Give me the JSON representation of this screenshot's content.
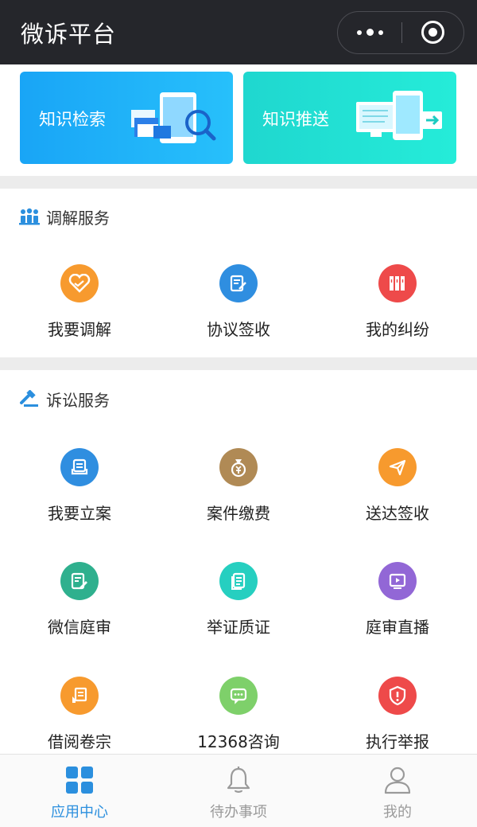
{
  "header": {
    "title": "微诉平台"
  },
  "banners": [
    {
      "label": "知识检索",
      "icon": "search-document-illustration"
    },
    {
      "label": "知识推送",
      "icon": "push-devices-illustration"
    }
  ],
  "mediation": {
    "title": "调解服务",
    "items": [
      {
        "label": "我要调解",
        "icon": "handshake-heart-icon",
        "color": "#f79a2e"
      },
      {
        "label": "协议签收",
        "icon": "edit-document-icon",
        "color": "#2f8ee0"
      },
      {
        "label": "我的纠纷",
        "icon": "folders-icon",
        "color": "#ee4a4a"
      }
    ]
  },
  "litigation": {
    "title": "诉讼服务",
    "items": [
      {
        "label": "我要立案",
        "icon": "file-stack-icon",
        "color": "#2f8ee0"
      },
      {
        "label": "案件缴费",
        "icon": "money-bag-icon",
        "color": "#b08a55"
      },
      {
        "label": "送达签收",
        "icon": "paper-plane-icon",
        "color": "#f79a2e"
      },
      {
        "label": "微信庭审",
        "icon": "document-pen-icon",
        "color": "#2fb08e"
      },
      {
        "label": "举证质证",
        "icon": "copy-document-icon",
        "color": "#26cfc0"
      },
      {
        "label": "庭审直播",
        "icon": "video-play-icon",
        "color": "#9267d6"
      },
      {
        "label": "借阅卷宗",
        "icon": "archive-hand-icon",
        "color": "#f79a2e"
      },
      {
        "label": "12368咨询",
        "icon": "chat-bubble-icon",
        "color": "#7ed06a"
      },
      {
        "label": "执行举报",
        "icon": "shield-alert-icon",
        "color": "#ee4a4a"
      }
    ]
  },
  "tabbar": {
    "tabs": [
      {
        "label": "应用中心",
        "icon": "grid-apps-icon",
        "active": true
      },
      {
        "label": "待办事项",
        "icon": "bell-icon",
        "active": false
      },
      {
        "label": "我的",
        "icon": "user-icon",
        "active": false
      }
    ],
    "active_color": "#2b8fde",
    "inactive_color": "#9a9a9a"
  }
}
